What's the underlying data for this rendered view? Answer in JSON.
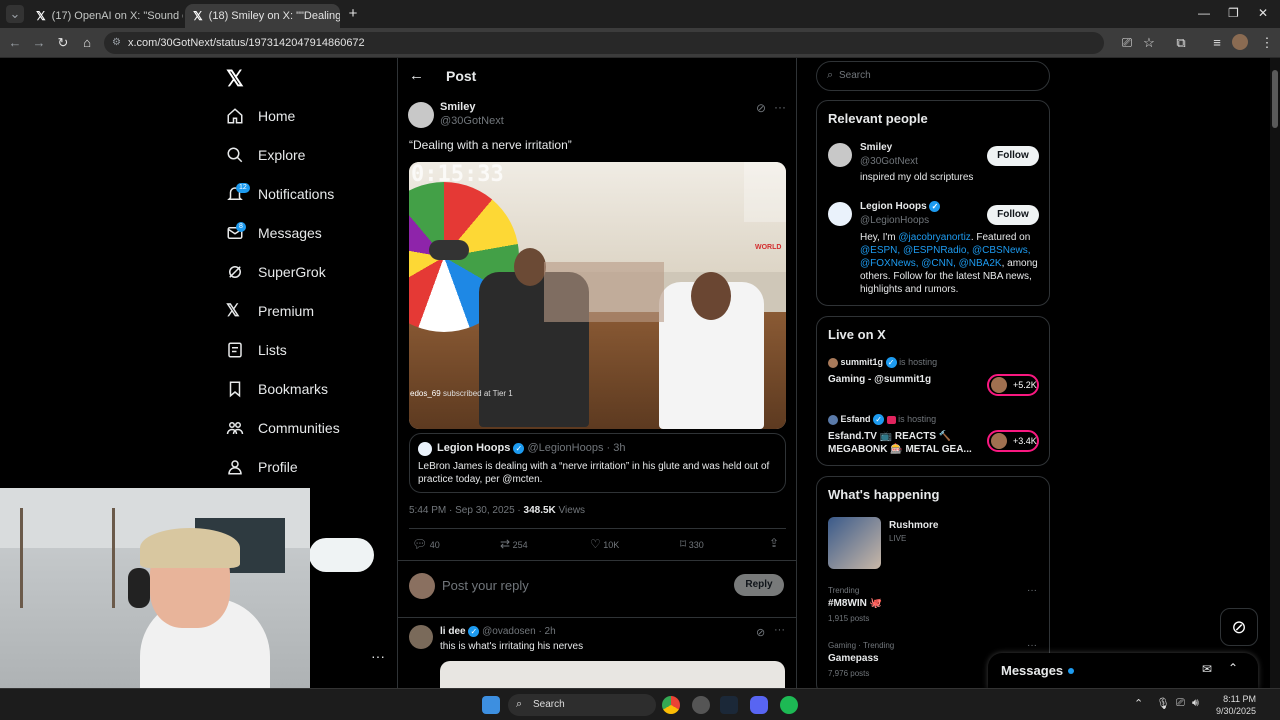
{
  "browser": {
    "tabs": [
      {
        "label": "(17) OpenAI on X: \"Sound on. h"
      },
      {
        "label": "(18) Smiley on X: \"\"Dealing with"
      }
    ],
    "url": "x.com/30GotNext/status/1973142047914860672"
  },
  "sidebar": {
    "items": [
      {
        "label": "Home"
      },
      {
        "label": "Explore"
      },
      {
        "label": "Notifications",
        "badge": "12"
      },
      {
        "label": "Messages",
        "badge": "8"
      },
      {
        "label": "SuperGrok"
      },
      {
        "label": "Premium"
      },
      {
        "label": "Lists"
      },
      {
        "label": "Bookmarks"
      },
      {
        "label": "Communities"
      },
      {
        "label": "Profile"
      }
    ],
    "more": "···"
  },
  "post": {
    "header_title": "Post",
    "author_name": "Smiley",
    "author_handle": "@30GotNext",
    "text": "“Dealing with a nerve irritation”",
    "media_timer": "0:15:33",
    "media_overlay_sub": "edos_69",
    "media_overlay_sub_suffix": "subscribed at Tier 1",
    "media_overlay_world": "WORLD",
    "quote": {
      "name": "Legion Hoops",
      "handle": "@LegionHoops",
      "time": "· 3h",
      "text": "LeBron James is dealing with a “nerve irritation” in his glute and was held out of practice today, per @mcten."
    },
    "timestamp": "5:44 PM · Sep 30, 2025 ·",
    "views_count": "348.5K",
    "views_label": "Views",
    "stats": {
      "replies": "40",
      "reposts": "254",
      "likes": "10K",
      "bookmarks": "330"
    },
    "reply_placeholder": "Post your reply",
    "reply_button": "Reply"
  },
  "reply_tweet": {
    "name": "li dee",
    "handle": "@ovadosen",
    "time": "· 2h",
    "text": "this is what's irritating his nerves"
  },
  "search": {
    "placeholder": "Search"
  },
  "relevant": {
    "title": "Relevant people",
    "people": [
      {
        "name": "Smiley",
        "handle": "@30GotNext",
        "bio": "inspired my old scriptures",
        "follow": "Follow"
      },
      {
        "name": "Legion Hoops",
        "handle": "@LegionHoops",
        "bio_prefix": "Hey, I'm ",
        "bio_link1": "@jacobryanortiz",
        "bio_mid1": ". Featured on",
        "bio_links2": "@ESPN, @ESPNRadio, @CBSNews,",
        "bio_links3": "@FOXNews, @CNN, @NBA2K",
        "bio_end": ", among others. Follow for the latest NBA news, highlights and rumors.",
        "follow": "Follow"
      }
    ]
  },
  "live": {
    "title": "Live on X",
    "items": [
      {
        "host": "summit1g",
        "hosting": "is hosting",
        "title": "Gaming - @summit1g",
        "count": "+5.2K"
      },
      {
        "host": "Esfand",
        "hosting": "is hosting",
        "title": "Esfand.TV 📺 REACTS 🔨 MEGABONK 🎰 METAL GEA...",
        "count": "+3.4K"
      }
    ]
  },
  "happening": {
    "title": "What's happening",
    "live_item": {
      "title": "Rushmore",
      "status": "LIVE"
    },
    "trends": [
      {
        "meta": "Trending",
        "name": "#M8WIN 🐙",
        "posts": "1,915 posts"
      },
      {
        "meta": "Gaming · Trending",
        "name": "Gamepass",
        "posts": "7,976 posts"
      }
    ]
  },
  "messages_drawer": {
    "label": "Messages"
  },
  "taskbar": {
    "search": "Search",
    "time": "8:11 PM",
    "date": "9/30/2025"
  }
}
